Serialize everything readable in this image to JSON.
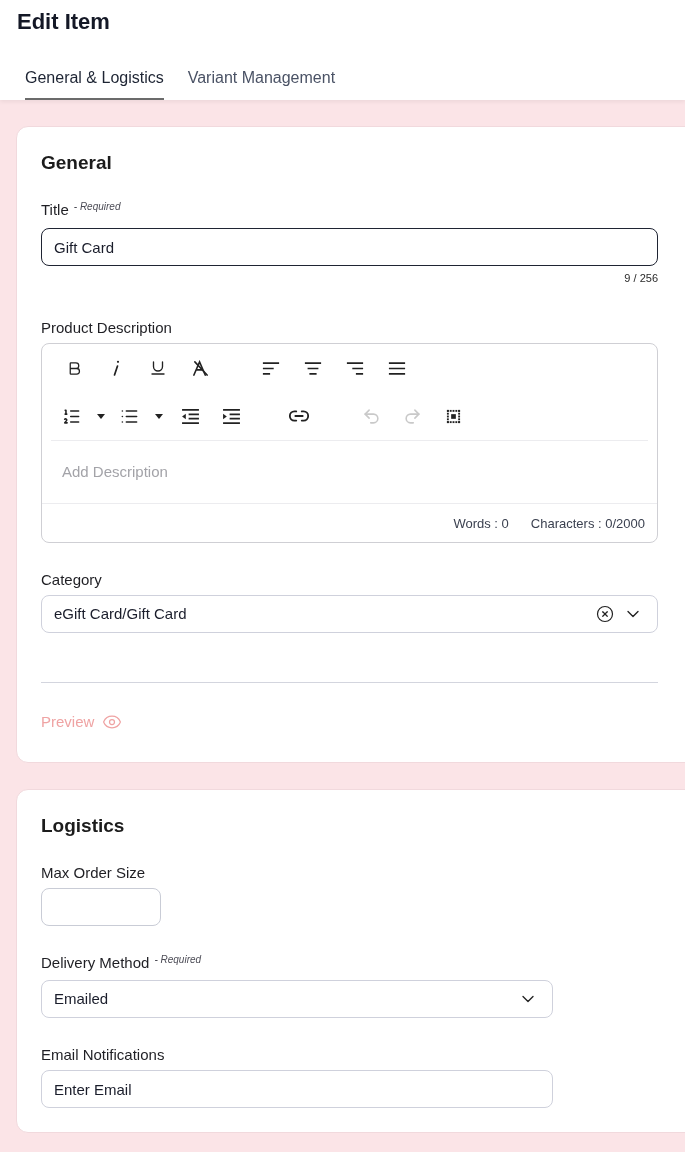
{
  "page": {
    "title": "Edit Item"
  },
  "tabs": [
    {
      "label": "General & Logistics",
      "selected": true
    },
    {
      "label": "Variant Management",
      "selected": false
    }
  ],
  "general": {
    "heading": "General",
    "title_field": {
      "label": "Title",
      "note": "- Required",
      "value": "Gift Card",
      "focused": true,
      "counter": "9 / 256"
    },
    "description": {
      "label": "Product Description",
      "toolbar": [
        [
          {
            "kind": "button",
            "disabled": false
          },
          {
            "kind": "button",
            "disabled": false
          },
          {
            "kind": "button",
            "disabled": false
          },
          {
            "kind": "button",
            "disabled": false
          },
          {
            "kind": "button",
            "disabled": false
          },
          {
            "kind": "button",
            "disabled": false
          },
          {
            "kind": "button",
            "disabled": false
          },
          {
            "kind": "button",
            "disabled": false
          }
        ],
        [
          {
            "kind": "split",
            "disabled": false
          },
          {
            "kind": "split",
            "disabled": false
          },
          {
            "kind": "button",
            "disabled": false
          },
          {
            "kind": "button",
            "disabled": false
          },
          {
            "kind": "button",
            "disabled": false
          },
          {
            "kind": "button",
            "disabled": true
          },
          {
            "kind": "button",
            "disabled": true
          },
          {
            "kind": "button",
            "disabled": false
          }
        ]
      ],
      "placeholder": "Add Description",
      "words": "Words : 0",
      "characters": "Characters : 0/2000"
    },
    "category": {
      "label": "Category",
      "value": "eGift Card/Gift Card"
    },
    "preview": {
      "label": "Preview"
    }
  },
  "logistics": {
    "heading": "Logistics",
    "max_order_size": {
      "label": "Max Order Size"
    },
    "delivery_method": {
      "label": "Delivery Method",
      "note": "- Required",
      "value": "Emailed"
    },
    "email_notifications": {
      "label": "Email Notifications",
      "placeholder": "Enter Email"
    }
  }
}
